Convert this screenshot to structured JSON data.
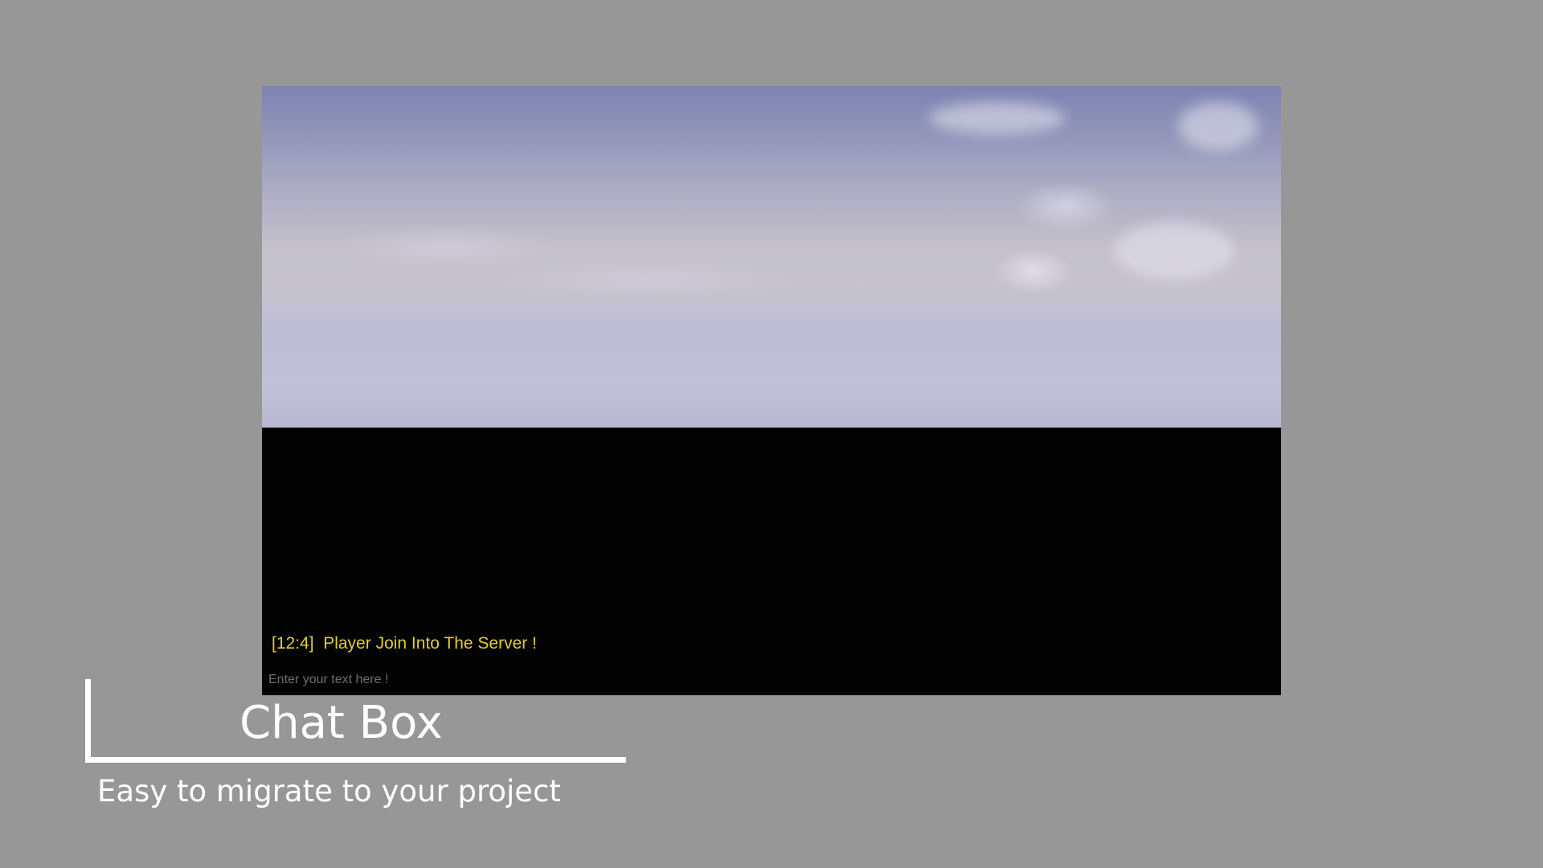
{
  "colors": {
    "background": "#979797",
    "chat_message": "#e2cf2f",
    "placeholder": "#6e6e6e",
    "title": "#ffffff",
    "ground": "#020202"
  },
  "game_view": {
    "chat": {
      "messages": [
        {
          "text": "[12:4]  Player Join Into The Server !"
        }
      ],
      "input": {
        "placeholder": "Enter your text here !",
        "value": ""
      }
    }
  },
  "caption": {
    "title": "Chat Box",
    "subtitle": "Easy to migrate to your project"
  }
}
